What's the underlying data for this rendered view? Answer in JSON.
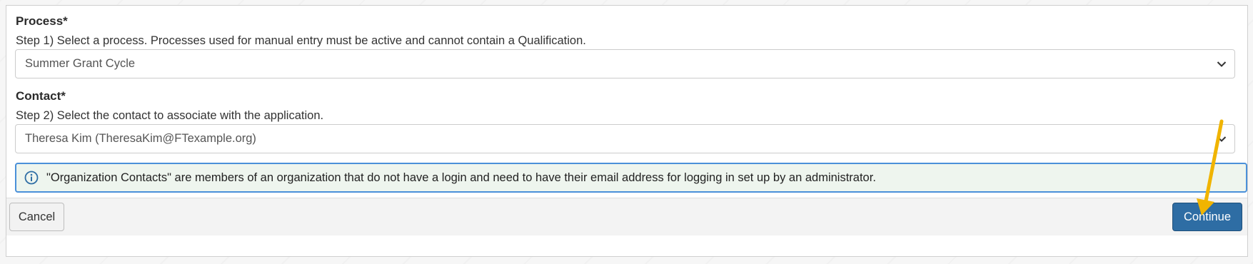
{
  "process": {
    "title": "Process*",
    "step": "Step 1) Select a process. Processes used for manual entry must be active and cannot contain a Qualification.",
    "selected": "Summer Grant Cycle"
  },
  "contact": {
    "title": "Contact*",
    "step": "Step 2) Select the contact to associate with the application.",
    "selected": "Theresa Kim (TheresaKim@FTexample.org)"
  },
  "info": {
    "icon": "info-circle-icon",
    "text": "\"Organization Contacts\" are members of an organization that do not have a login and need to have their email address for logging in set up by an administrator."
  },
  "footer": {
    "cancel_label": "Cancel",
    "continue_label": "Continue"
  },
  "colors": {
    "primary_button": "#2e6da4",
    "info_border": "#4a90d9",
    "info_background": "#eef5ee",
    "annotation_arrow": "#f0b400"
  }
}
